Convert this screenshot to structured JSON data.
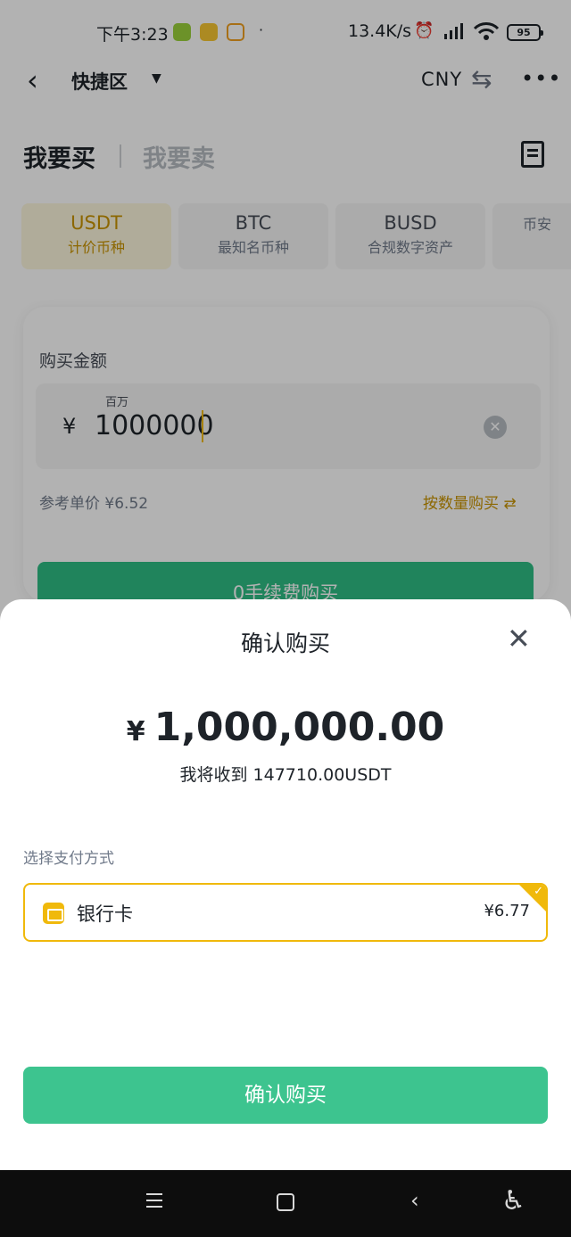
{
  "status_bar": {
    "time": "下午3:23",
    "dot": "·",
    "network_speed": "13.4K/s",
    "battery": "95",
    "icons": [
      "lime-app-icon",
      "yellow-app-icon",
      "message-app-icon",
      "alarm-icon",
      "hd-signal-icon",
      "wifi-icon"
    ]
  },
  "header": {
    "back_icon": "back-arrow-icon",
    "title": "快捷区",
    "currency": "CNY",
    "swap_icon": "swap-arrows-icon",
    "more_icon": "more-dots-icon"
  },
  "tabs": {
    "buy": "我要买",
    "sell": "我要卖"
  },
  "coins": [
    {
      "name": "USDT",
      "desc": "计价币种",
      "active": true
    },
    {
      "name": "BTC",
      "desc": "最知名币种",
      "active": false
    },
    {
      "name": "BUSD",
      "desc": "合规数字资产",
      "active": false
    },
    {
      "name": "",
      "desc": "币安",
      "active": false
    }
  ],
  "amount_section": {
    "label": "购买金额",
    "unit_hint": "百万",
    "currency_symbol": "¥",
    "value": "1000000",
    "reference_price": "参考单价 ¥6.52",
    "toggle_label": "按数量购买 ⇄",
    "submit_label": "0手续费购买"
  },
  "dialog": {
    "title": "确认购买",
    "currency_symbol": "¥",
    "total": "1,000,000.00",
    "receive_text": "我将收到 147710.00USDT",
    "payment_label": "选择支付方式",
    "payment_method": {
      "name": "银行卡",
      "price": "¥6.77",
      "icon": "bank-card-icon",
      "selected": true
    },
    "confirm_label": "确认购买"
  },
  "colors": {
    "accent": "#f0b90b",
    "green": "#3dc48f",
    "text": "#1e2329"
  }
}
